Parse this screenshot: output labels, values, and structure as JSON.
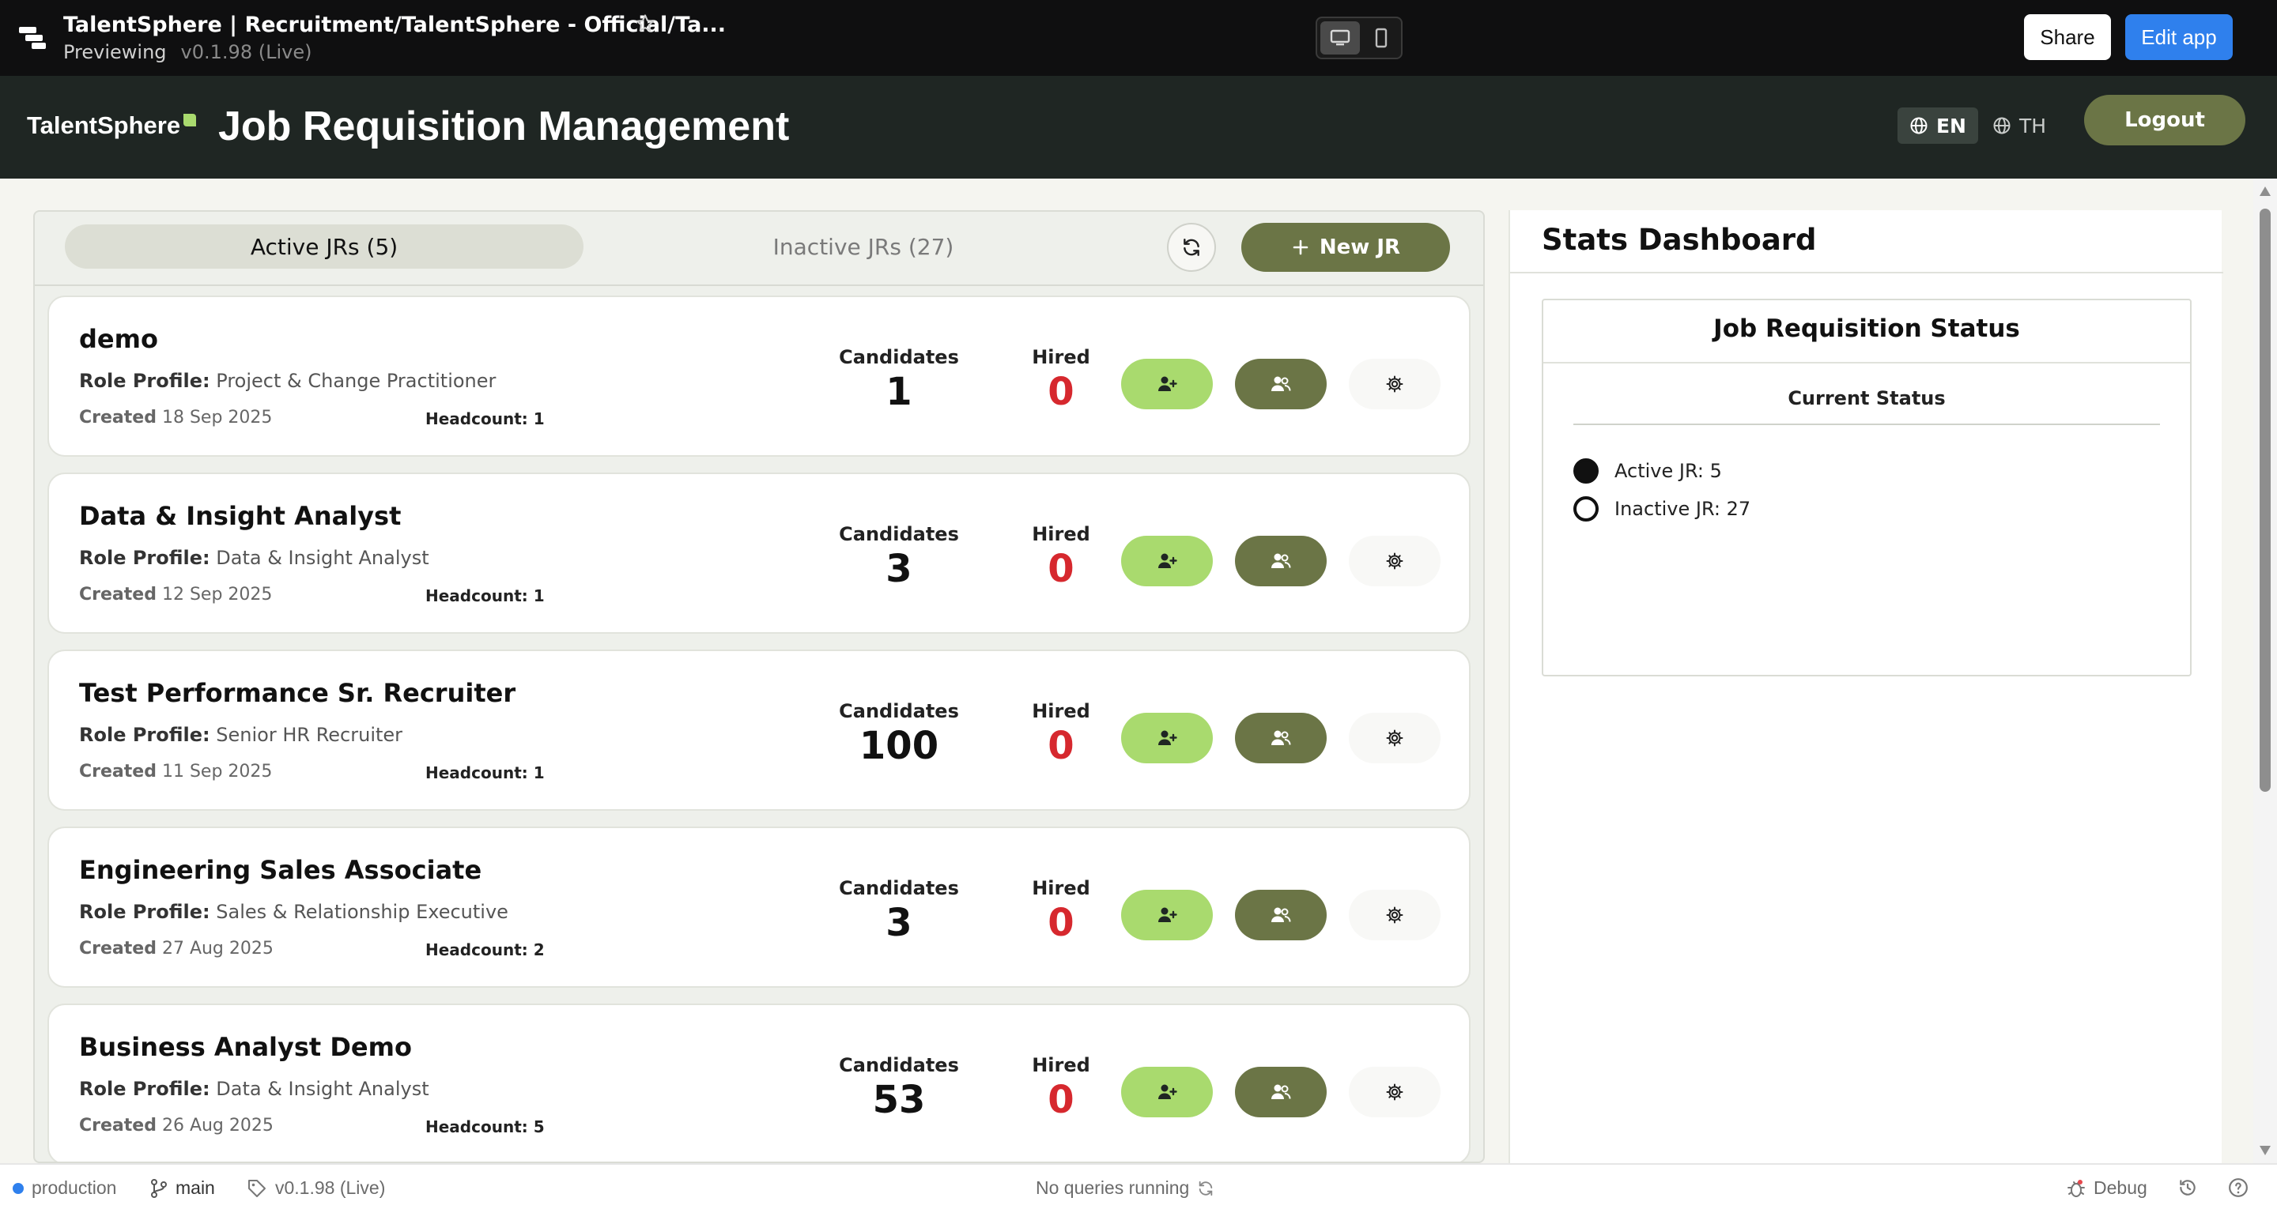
{
  "topbar": {
    "title": "TalentSphere | Recruitment/TalentSphere - Official/Ta...",
    "mode": "Previewing",
    "version": "v0.1.98 (Live)",
    "share_label": "Share",
    "edit_label": "Edit app"
  },
  "header": {
    "brand": "TalentSphere",
    "title": "Job Requisition Management",
    "lang_en": "EN",
    "lang_th": "TH",
    "logout_label": "Logout",
    "brand_color": "#a9da6e"
  },
  "tabs": {
    "active_label": "Active JRs (5)",
    "inactive_label": "Inactive JRs (27)",
    "new_jr_label": "New JR"
  },
  "labels": {
    "role_profile": "Role Profile:",
    "created": "Created",
    "headcount": "Headcount:",
    "candidates": "Candidates",
    "hired": "Hired"
  },
  "jrs": [
    {
      "title": "demo",
      "role_profile": "Project & Change Practitioner",
      "created": "18 Sep 2025",
      "headcount": "1",
      "candidates": "1",
      "hired": "0"
    },
    {
      "title": "Data & Insight Analyst",
      "role_profile": "Data & Insight Analyst",
      "created": "12 Sep 2025",
      "headcount": "1",
      "candidates": "3",
      "hired": "0"
    },
    {
      "title": "Test Performance Sr. Recruiter",
      "role_profile": "Senior HR Recruiter",
      "created": "11 Sep 2025",
      "headcount": "1",
      "candidates": "100",
      "hired": "0"
    },
    {
      "title": "Engineering Sales Associate",
      "role_profile": "Sales & Relationship Executive",
      "created": "27 Aug 2025",
      "headcount": "2",
      "candidates": "3",
      "hired": "0"
    },
    {
      "title": "Business Analyst Demo",
      "role_profile": "Data & Insight Analyst",
      "created": "26 Aug 2025",
      "headcount": "5",
      "candidates": "53",
      "hired": "0"
    }
  ],
  "stats": {
    "title": "Stats Dashboard",
    "card_title": "Job Requisition Status",
    "subtitle": "Current Status",
    "active_label": "Active JR: 5",
    "inactive_label": "Inactive JR: 27"
  },
  "bottombar": {
    "environment": "production",
    "branch": "main",
    "version": "v0.1.98 (Live)",
    "queries": "No queries running",
    "debug_label": "Debug"
  },
  "icons": {
    "app": "appsmith-logo-icon",
    "star": "star-icon",
    "desktop": "desktop-icon",
    "mobile": "mobile-icon",
    "globe": "globe-icon",
    "refresh": "refresh-icon",
    "plus": "plus-icon",
    "add_candidate": "user-plus-icon",
    "candidates": "users-icon",
    "settings": "gear-icon"
  }
}
